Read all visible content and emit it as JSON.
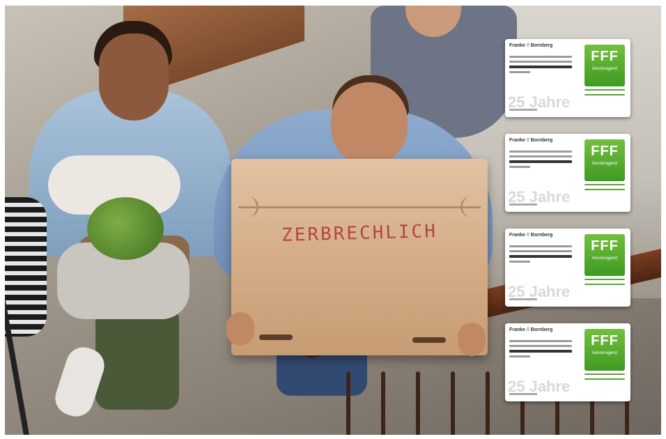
{
  "image": {
    "box_label": "ZERBRECHLICH"
  },
  "badges": [
    {
      "brand_left": "Franke",
      "brand_sep": "//",
      "brand_right": "Bornberg",
      "seal": "FFF",
      "seal_sub": "hervorragend",
      "watermark": "25 Jahre"
    },
    {
      "brand_left": "Franke",
      "brand_sep": "//",
      "brand_right": "Bornberg",
      "seal": "FFF",
      "seal_sub": "hervorragend",
      "watermark": "25 Jahre"
    },
    {
      "brand_left": "Franke",
      "brand_sep": "//",
      "brand_right": "Bornberg",
      "seal": "FFF",
      "seal_sub": "hervorragend",
      "watermark": "25 Jahre"
    },
    {
      "brand_left": "Franke",
      "brand_sep": "//",
      "brand_right": "Bornberg",
      "seal": "FFF",
      "seal_sub": "hervorragend",
      "watermark": "25 Jahre"
    }
  ],
  "colors": {
    "seal_green": "#4fa82c",
    "box_text_red": "#b2473f",
    "cardboard": "#d5ad87"
  }
}
